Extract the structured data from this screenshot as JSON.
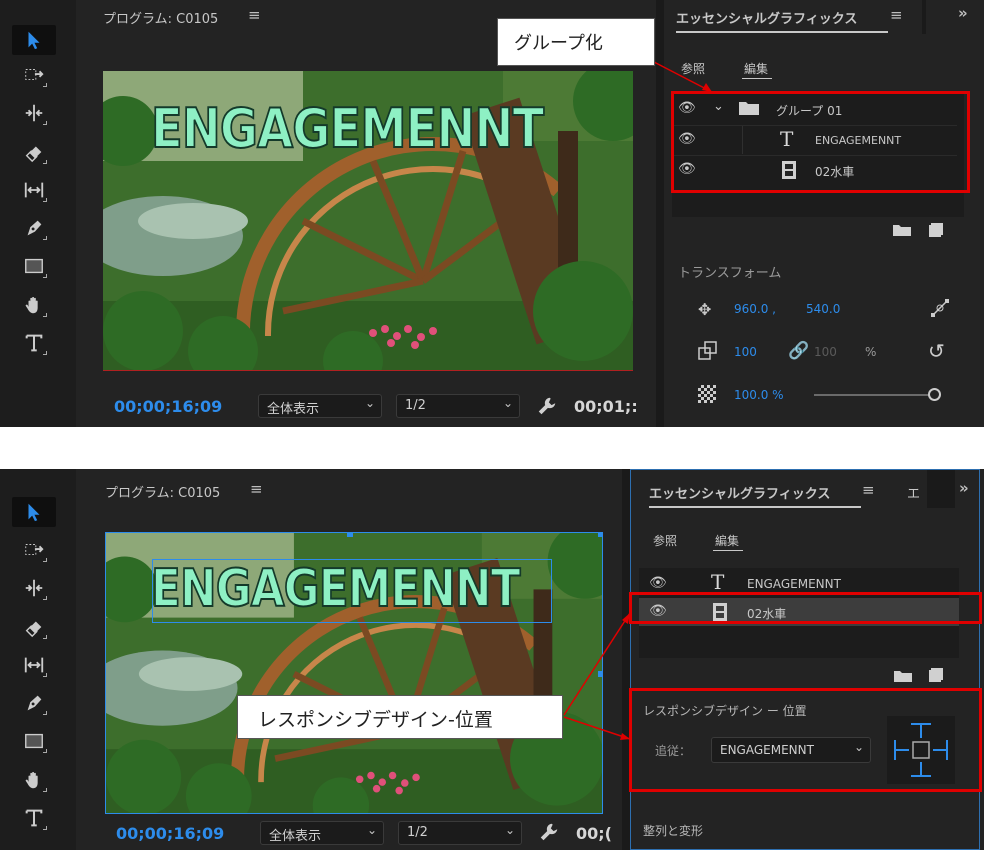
{
  "top": {
    "program_title": "プログラム: C0105",
    "overlay_text": "ENGAGEMENNT",
    "timecode": "00;00;16;09",
    "zoom_select": "全体表示",
    "resolution_select": "1/2",
    "duration": "00;01;:",
    "panel_title": "エッセンシャルグラフィックス",
    "tab_browse": "参照",
    "tab_edit": "編集",
    "layers": [
      {
        "name": "グループ 01",
        "icon": "folder-icon"
      },
      {
        "name": "ENGAGEMENNT",
        "icon": "text-icon"
      },
      {
        "name": "02水車",
        "icon": "film-icon"
      }
    ],
    "callout": "グループ化",
    "transform_title": "トランスフォーム",
    "position_x": "960.0 ,",
    "position_y": "540.0",
    "scale": "100",
    "scale_linked": "100",
    "percent": "%",
    "opacity": "100.0 %"
  },
  "bottom": {
    "program_title": "プログラム: C0105",
    "overlay_text": "ENGAGEMENNT",
    "timecode": "00;00;16;09",
    "zoom_select": "全体表示",
    "resolution_select": "1/2",
    "duration": "00;(",
    "panel_title": "エッセンシャルグラフィックス",
    "panel_title2": "エ",
    "tab_browse": "参照",
    "tab_edit": "編集",
    "layers": [
      {
        "name": "ENGAGEMENNT",
        "icon": "text-icon"
      },
      {
        "name": "02水車",
        "icon": "film-icon"
      }
    ],
    "responsive_title": "レスポンシブデザイン ー 位置",
    "follow_label": "追従：",
    "follow_value": "ENGAGEMENNT",
    "callout": "レスポンシブデザイン-位置",
    "align_title": "整列と変形"
  },
  "colors": {
    "accent": "#2d8ceb",
    "highlight": "#e00000",
    "panel_bg": "#232323"
  }
}
